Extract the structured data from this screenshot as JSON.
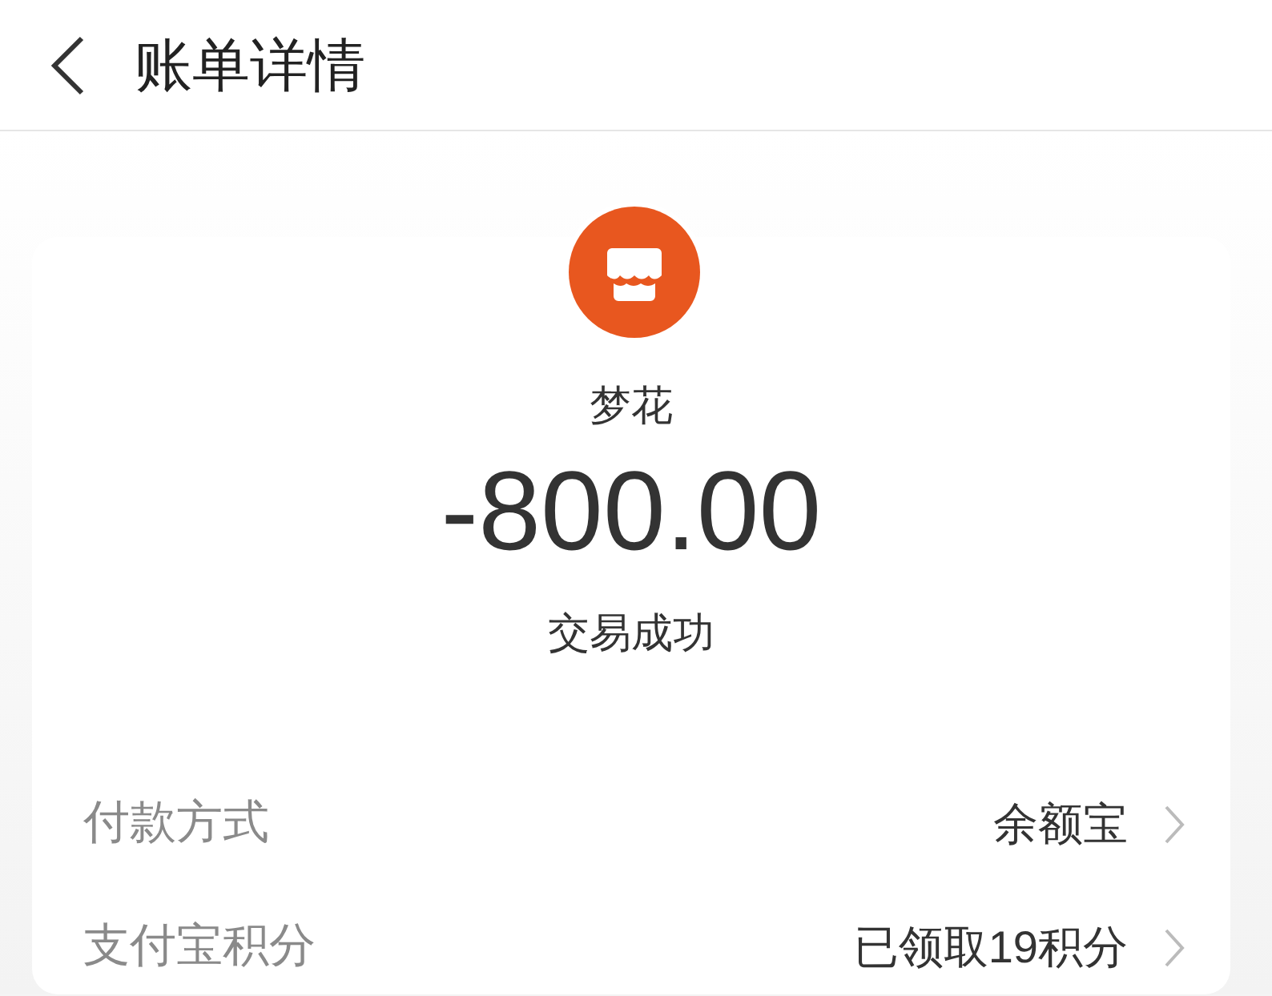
{
  "header": {
    "title": "账单详情"
  },
  "merchant": {
    "name": "梦花"
  },
  "amount": "-800.00",
  "status": "交易成功",
  "rows": [
    {
      "label": "付款方式",
      "value": "余额宝"
    },
    {
      "label": "支付宝积分",
      "value": "已领取19积分"
    }
  ]
}
